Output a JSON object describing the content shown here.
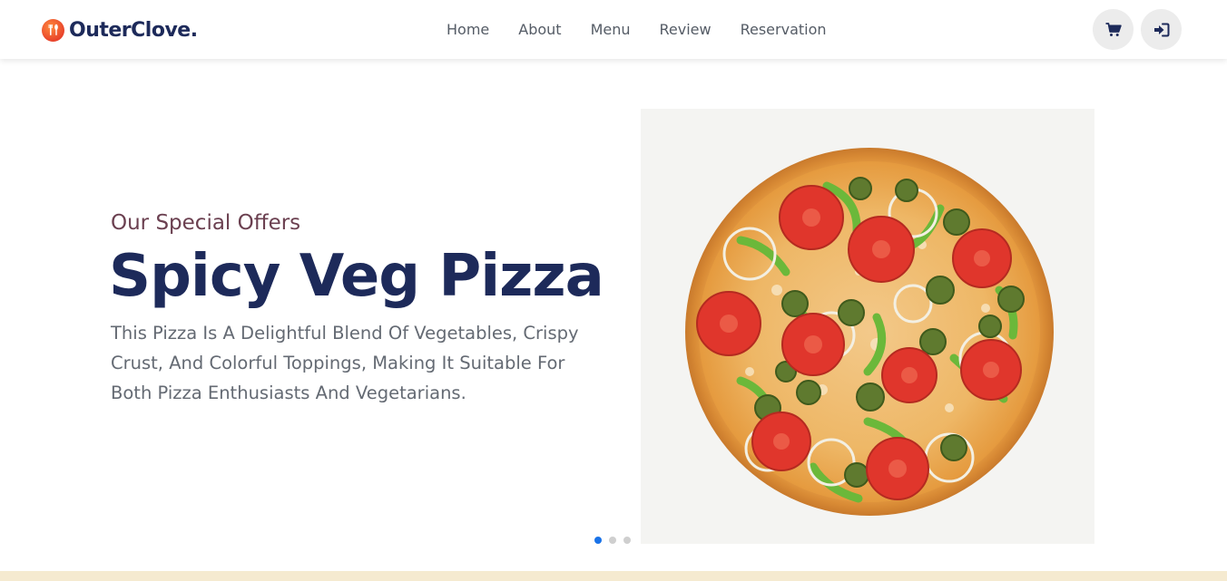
{
  "brand": {
    "name": "OuterClove."
  },
  "nav": {
    "items": [
      {
        "label": "Home"
      },
      {
        "label": "About"
      },
      {
        "label": "Menu"
      },
      {
        "label": "Review"
      },
      {
        "label": "Reservation"
      }
    ]
  },
  "actions": {
    "cart_icon": "cart-icon",
    "login_icon": "login-icon"
  },
  "hero": {
    "subtitle": "Our Special Offers",
    "title": "Spicy Veg Pizza",
    "description": "This Pizza Is A Delightful Blend Of Vegetables, Crispy Crust, And Colorful Toppings, Making It Suitable For Both Pizza Enthusiasts And Vegetarians.",
    "image_icon": "pizza-image"
  },
  "carousel": {
    "slide_count": 3,
    "active_slide": 1
  },
  "colors": {
    "brand_navy": "#1d2a5a",
    "subtitle": "#6b4050",
    "dot_active": "#1a73e8",
    "band": "#f5ead0"
  }
}
